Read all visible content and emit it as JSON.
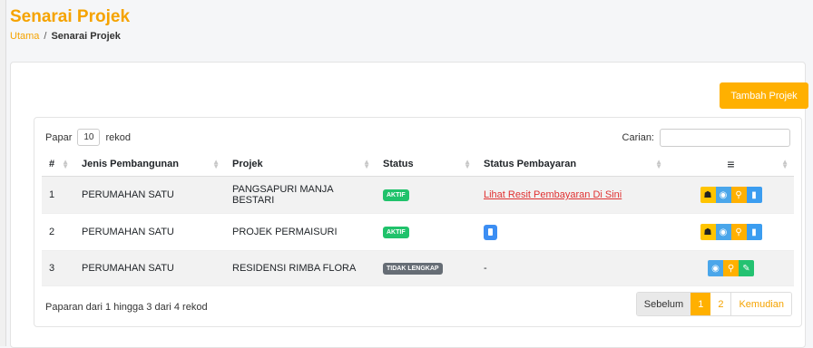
{
  "header": {
    "title": "Senarai Projek"
  },
  "breadcrumb": {
    "home": "Utama",
    "separator": "/",
    "current": "Senarai Projek"
  },
  "toolbar": {
    "add_label": "Tambah Projek"
  },
  "table_controls": {
    "length_prefix": "Papar",
    "length_value": "10",
    "length_suffix": "rekod",
    "search_label": "Carian:",
    "search_value": ""
  },
  "table": {
    "columns": [
      "#",
      "Jenis Pembangunan",
      "Projek",
      "Status",
      "Status Pembayaran",
      "≡"
    ],
    "rows": [
      {
        "no": "1",
        "jenis": "PERUMAHAN SATU",
        "projek": "PANGSAPURI MANJA BESTARI",
        "status": "AKTIF",
        "payment": "Lihat Resit Pembayaran Di Sini"
      },
      {
        "no": "2",
        "jenis": "PERUMAHAN SATU",
        "projek": "PROJEK PERMAISURI",
        "status": "AKTIF",
        "payment": ""
      },
      {
        "no": "3",
        "jenis": "PERUMAHAN SATU",
        "projek": "RESIDENSI RIMBA FLORA",
        "status": "TIDAK LENGKAP",
        "payment": "-"
      }
    ]
  },
  "footer": {
    "info": "Paparan dari 1 hingga 3 dari 4 rekod"
  },
  "pagination": {
    "prev": "Sebelum",
    "pages": [
      "1",
      "2"
    ],
    "next": "Kemudian"
  },
  "icons": {
    "building": "building-icon",
    "view": "eye-icon",
    "search": "search-icon",
    "doc": "document-icon",
    "edit": "edit-icon",
    "menu": "menu-icon"
  },
  "colors": {
    "accent": "#ffb000",
    "title": "#f5a300",
    "active_badge": "#20c26b",
    "incomplete_badge": "#666d75",
    "link": "#e03131"
  }
}
